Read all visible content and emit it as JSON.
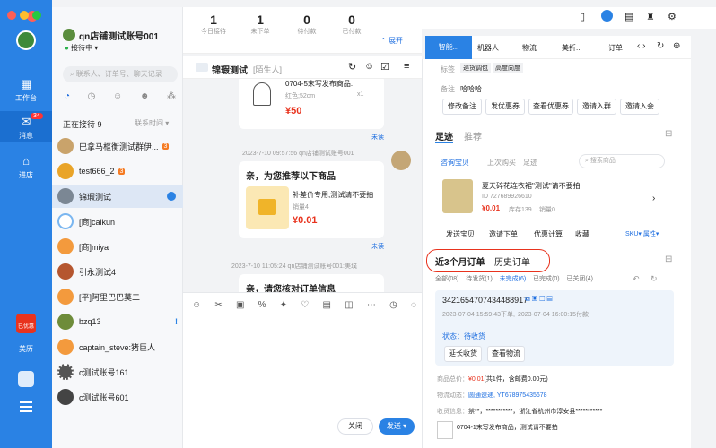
{
  "rail": {
    "work": "工作台",
    "msg": "消息",
    "msg_badge": "34",
    "store": "进店",
    "bottom_badge": "已优惠",
    "bottom_label": "美历"
  },
  "header": {
    "shop_name": "qn店铺测试账号001",
    "status": "接待中",
    "stats": [
      {
        "num": "1",
        "label": "今日接待"
      },
      {
        "num": "1",
        "label": "未下单"
      },
      {
        "num": "0",
        "label": "待付款"
      },
      {
        "num": "0",
        "label": "已付款"
      }
    ],
    "expand": "展开"
  },
  "search": {
    "placeholder": "联系人、订单号、聊天记录"
  },
  "list": {
    "section": "正在接待",
    "count": "9",
    "sort": "联系时间",
    "contacts": [
      {
        "name": "巴拿马枢衡测试群伊...",
        "tag": "3"
      },
      {
        "name": "test666_2",
        "tag": "3"
      },
      {
        "name": "锦瑕测试",
        "tag": ""
      },
      {
        "name": "[商]caikun",
        "tag": ""
      },
      {
        "name": "[商]miya",
        "tag": ""
      },
      {
        "name": "引永测试4",
        "tag": ""
      },
      {
        "name": "[平]阿里巴巴莫二",
        "tag": ""
      },
      {
        "name": "bzq13",
        "tag": ""
      },
      {
        "name": "captain_steve:猪巨人",
        "tag": ""
      },
      {
        "name": "c测试账号161",
        "tag": ""
      },
      {
        "name": "c测试账号601",
        "tag": ""
      }
    ]
  },
  "chat": {
    "title": "锦瑕测试",
    "tag": "[陌生人]",
    "msg1": {
      "title": "0704-5末写发布商品.",
      "spec": "红色;52cm",
      "qty": "x1",
      "price": "50"
    },
    "read": "未读",
    "time2": "2023-7-10 09:57:56",
    "sender2": "qn店铺测试账号001",
    "msg2": {
      "head": "亲，为您推荐以下商品",
      "item": "补差价专用,测试请不要拍",
      "sales": "销量4",
      "price": "0.01"
    },
    "time3": "2023-7-10 11:05:24",
    "sender3": "qn店铺测试账号001:美璞",
    "msg3": "亲，请您核对订单信息",
    "close": "关闭",
    "send": "发送"
  },
  "right": {
    "tabs": [
      "智能...",
      "机器人",
      "物流",
      "美折...",
      "订单"
    ],
    "label_k": "标签",
    "tags": [
      "递货调包",
      "高度向度"
    ],
    "note_k": "备注",
    "note_v": "哈哈哈",
    "actions": [
      "修改备注",
      "发优惠券",
      "查看优惠券",
      "邀请入群",
      "邀请入会"
    ],
    "foot": "足迹",
    "recommend": "推荐",
    "sub": [
      "咨询宝贝",
      "上次购买",
      "足迹"
    ],
    "search_ph": "搜索商品",
    "product": {
      "title": "夏天碎花连衣裙\"测试\"请不要拍",
      "id": "ID 727689926610",
      "price": "0.01",
      "stock": "库存139",
      "sales": "销量0"
    },
    "prod_actions": [
      "发送宝贝",
      "邀请下单",
      "优惠计算",
      "收藏"
    ],
    "sku": "SKU",
    "attr": "属性",
    "order_tabs": [
      "近3个月订单",
      "历史订单"
    ],
    "filter": [
      "全部(08)",
      "待发货(1)",
      "未完成(6)",
      "已完成(0)",
      "已关闭(4)"
    ],
    "order": {
      "no": "3421654707434488917",
      "t1": "2023-07-04 15:59:43下单,",
      "t2": "2023-07-04 16:00:15付款",
      "status": "状态：待收货",
      "b1": "延长收货",
      "b2": "查看物流",
      "amount_k": "商品总价：",
      "amount_v": "¥0.01",
      "amount_rest": "(共1件，含邮费0.00元)",
      "log_k": "物流动态：",
      "log_v": "圆通速递, YT678975435678",
      "addr_k": "收货信息：",
      "addr_v": "禁**，***********，浙江省杭州市淳安县***********",
      "item": "0704-1末写发布商品，测试请不要拍"
    }
  }
}
